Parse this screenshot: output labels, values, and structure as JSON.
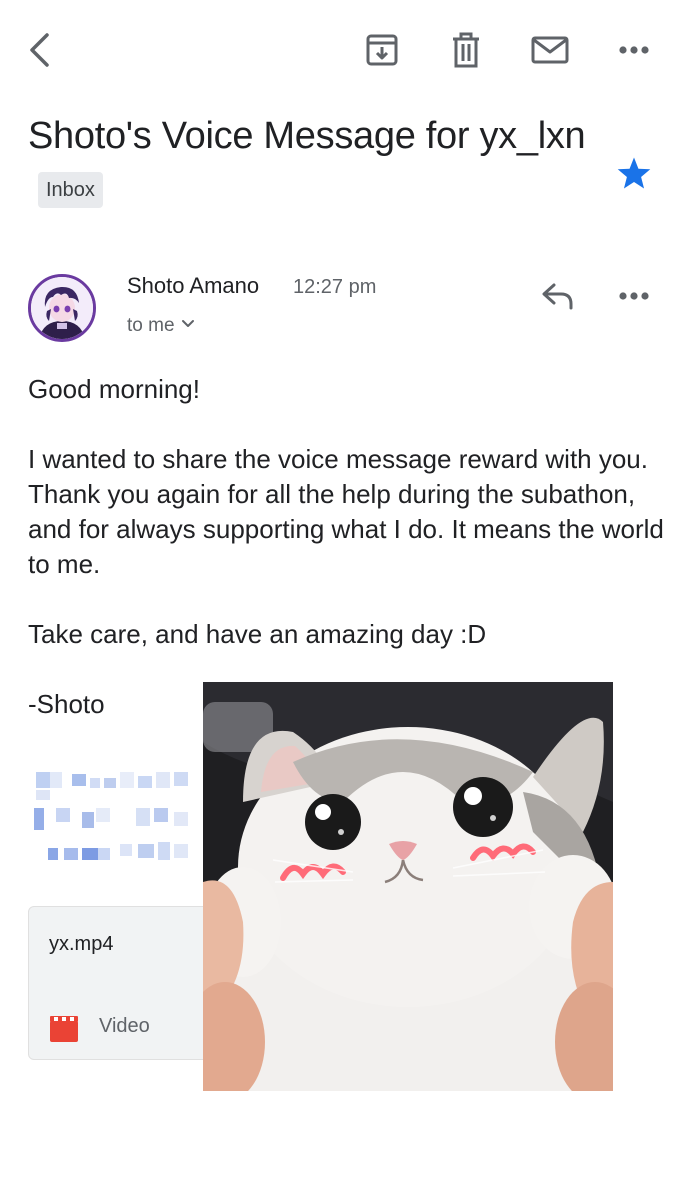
{
  "toolbar": {
    "back_icon": "back-arrow-icon",
    "archive_icon": "archive-icon",
    "delete_icon": "trash-icon",
    "mark_unread_icon": "mail-icon",
    "more_icon": "more-horizontal-icon"
  },
  "email": {
    "subject": "Shoto's Voice Message for yx_lxn",
    "label": "Inbox",
    "starred": true,
    "star_color": "#1a73e8",
    "sender_name": "Shoto Amano",
    "time": "12:27 pm",
    "recipient": "to me",
    "body": [
      "Good morning!",
      "I wanted to share the voice message reward with you. Thank you again for all the help during the subathon, and for always supporting what I do. It means the world to me.",
      "Take care, and have an amazing day :D",
      "-Shoto"
    ]
  },
  "attachment": {
    "file_name": "yx.mp4",
    "file_type": "Video",
    "icon": "video-file-icon",
    "icon_color": "#ea4335"
  },
  "colors": {
    "text_primary": "#202124",
    "text_secondary": "#5f6368",
    "badge_bg": "#e8eaed"
  }
}
